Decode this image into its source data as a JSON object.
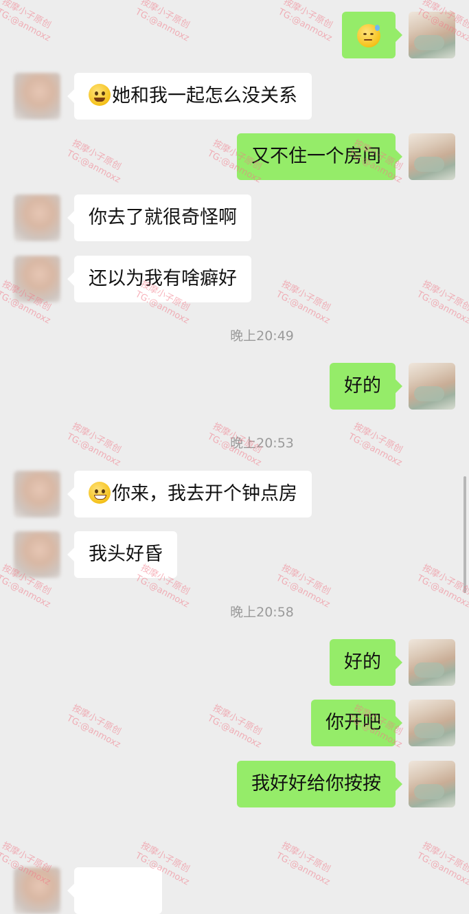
{
  "colors": {
    "background": "#ededed",
    "bubble_self": "#95ec69",
    "bubble_other": "#ffffff",
    "timestamp": "#9a9a9a",
    "watermark": "#f07887"
  },
  "messages": [
    {
      "side": "self",
      "emoji": "anxious-sweat-emoji-icon",
      "text": ""
    },
    {
      "side": "other",
      "emoji": "drooling-emoji-icon",
      "text": "她和我一起怎么没关系"
    },
    {
      "side": "self",
      "text": "又不住一个房间"
    },
    {
      "side": "other",
      "text": "你去了就很奇怪啊"
    },
    {
      "side": "other",
      "text": "还以为我有啥癖好"
    },
    {
      "side": "self",
      "text": "好的"
    },
    {
      "side": "other",
      "emoji": "grinning-emoji-icon",
      "text": "你来，我去开个钟点房"
    },
    {
      "side": "other",
      "text": "我头好昏"
    },
    {
      "side": "self",
      "text": "好的"
    },
    {
      "side": "self",
      "text": "你开吧"
    },
    {
      "side": "self",
      "text": "我好好给你按按"
    }
  ],
  "timestamps": [
    "晚上20:49",
    "晚上20:53",
    "晚上20:58"
  ],
  "watermark": {
    "line1": "按摩小子原创",
    "line2": "TG:@anmoxz"
  }
}
